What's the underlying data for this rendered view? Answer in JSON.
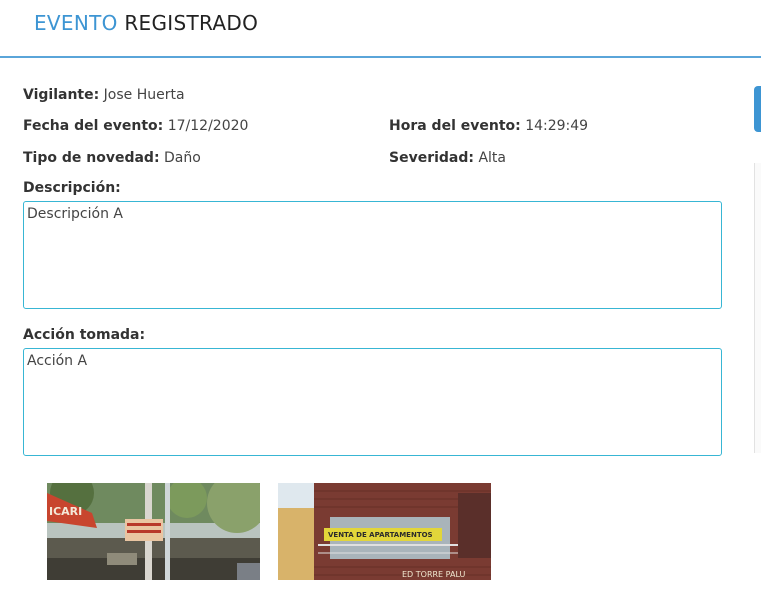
{
  "header": {
    "title_part1": "EVENTO",
    "title_part2": "REGISTRADO",
    "accent_color": "#3d95d3"
  },
  "event": {
    "guard_label": "Vigilante:",
    "guard_value": "Jose Huerta",
    "date_label": "Fecha del evento:",
    "date_value": "17/12/2020",
    "time_label": "Hora del evento:",
    "time_value": "14:29:49",
    "type_label": "Tipo de novedad:",
    "type_value": "Daño",
    "severity_label": "Severidad:",
    "severity_value": "Alta"
  },
  "description": {
    "label": "Descripción:",
    "value": "Descripción A"
  },
  "action": {
    "label": "Acción tomada:",
    "value": "Acción A"
  },
  "photos": [
    {
      "name": "street-photo",
      "sign_text": "ICARI"
    },
    {
      "name": "building-photo",
      "sign_text": "VENTA DE APARTAMENTOS",
      "facade_text": "ED TORRE PALU"
    }
  ]
}
